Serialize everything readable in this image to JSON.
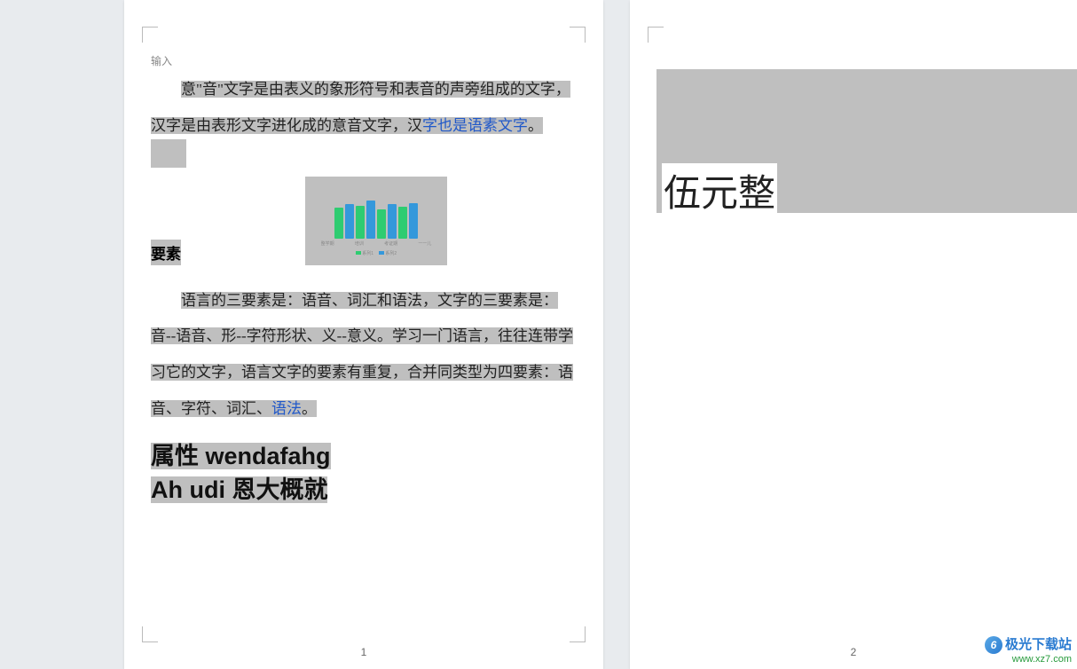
{
  "page1": {
    "input_placeholder": "输入",
    "para1_pre": "意\"音\"文字是由表义的象形符号和表音的声旁组成的文字，汉字是由表形文字进化成的意音文字，汉",
    "para1_link": "字也是语素文字",
    "para1_post": "。",
    "section_title": "要素",
    "para2_pre": "语言的三要素是：语音、词汇和语法，文字的三要素是：音--语音、形--字符形状、义--意义。学习一门语言，往往连带学习它的文字，语言文字的要素有重复，合并同类型为四要素：语音、字符、词汇、",
    "para2_link": "语法",
    "para2_post": "。",
    "heading_line1": "属性 wendafahg",
    "heading_line2": "Ah udi 恩大概就",
    "page_number": "1"
  },
  "page2": {
    "big_text": "伍元整",
    "page_number": "2"
  },
  "chart_data": {
    "type": "bar",
    "categories": [
      "整学期",
      "培训",
      "考证期",
      "一一儿"
    ],
    "series": [
      {
        "name": "系列1",
        "color": "#2ecc71",
        "values": [
          52,
          56,
          50,
          54
        ]
      },
      {
        "name": "系列2",
        "color": "#3498db",
        "values": [
          58,
          64,
          58,
          60
        ]
      }
    ],
    "ylim": [
      0,
      70
    ],
    "title": "",
    "xlabel": "",
    "ylabel": ""
  },
  "watermark": {
    "line1": "极光下载站",
    "line2": "www.xz7.com"
  }
}
